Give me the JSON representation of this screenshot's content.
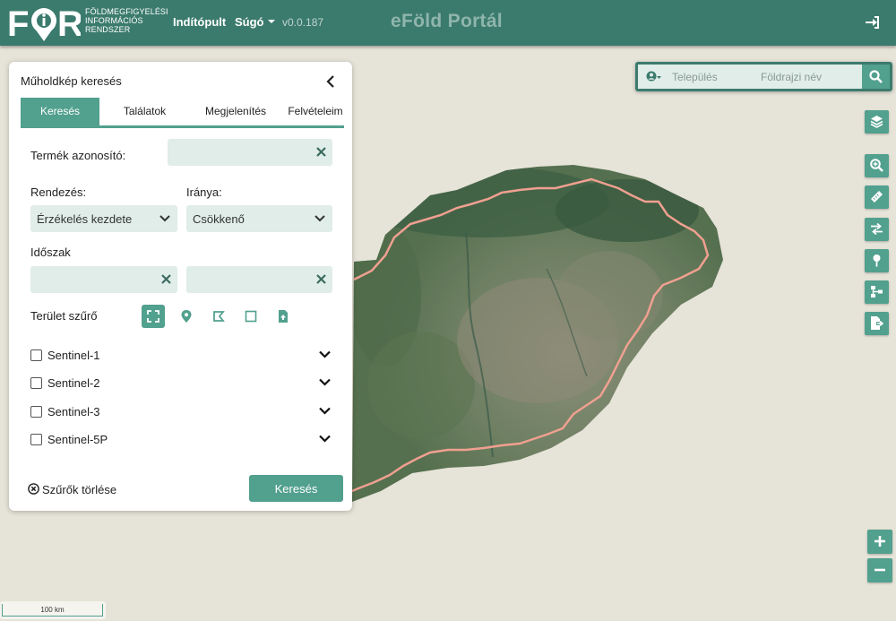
{
  "header": {
    "logo_text": "FOR",
    "logo_subtitle": [
      "FÖLDMEGFIGYELÉSI",
      "INFORMÁCIÓS",
      "RENDSZER"
    ],
    "nav": {
      "dashboard": "Indítópult",
      "help": "Súgó",
      "version": "v0.0.187"
    },
    "title": "eFöld Portál",
    "login_icon": "sign-in-icon"
  },
  "panel": {
    "title": "Műholdkép keresés",
    "tabs": [
      "Keresés",
      "Találatok",
      "Megjelenítés",
      "Felvételeim"
    ],
    "active_tab": 0,
    "product_id": {
      "label": "Termék azonosító:",
      "value": ""
    },
    "sort": {
      "label": "Rendezés:",
      "value": "Érzékelés kezdete"
    },
    "direction": {
      "label": "Iránya:",
      "value": "Csökkenő"
    },
    "period": {
      "label": "Időszak",
      "from": "",
      "to": ""
    },
    "area_filter": {
      "label": "Terület szűrő",
      "tools": [
        "extent-icon",
        "map-marker-icon",
        "polygon-icon",
        "rectangle-icon",
        "file-upload-icon"
      ],
      "active_tool": 0
    },
    "satellites": [
      {
        "label": "Sentinel-1",
        "checked": false
      },
      {
        "label": "Sentinel-2",
        "checked": false
      },
      {
        "label": "Sentinel-3",
        "checked": false
      },
      {
        "label": "Sentinel-5P",
        "checked": false
      }
    ],
    "clear_filters": "Szűrők törlése",
    "search_button": "Keresés"
  },
  "place_search": {
    "settlement_placeholder": "Település",
    "geo_name_placeholder": "Földrajzi név"
  },
  "map_tools": [
    "layers-icon",
    "zoom-to-icon",
    "ruler-icon",
    "swap-icon",
    "map-pin-icon",
    "sitemap-icon",
    "file-export-icon"
  ],
  "zoom": {
    "in": "+",
    "out": "−"
  },
  "scale": "100 km",
  "colors": {
    "primary": "#3b7b6d",
    "accent": "#52a08e",
    "input_bg": "#e0ede9",
    "border_line": "#f0a090"
  }
}
